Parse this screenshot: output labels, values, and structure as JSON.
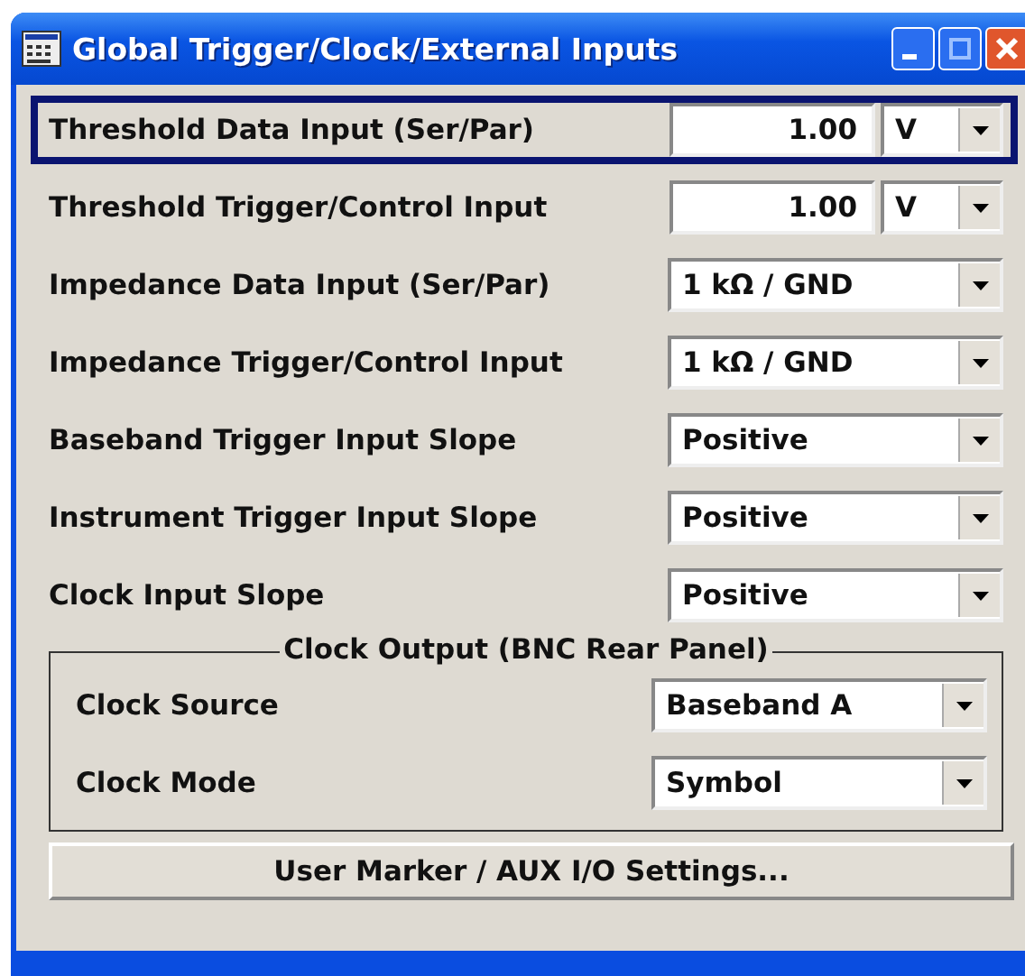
{
  "window": {
    "title": "Global Trigger/Clock/External Inputs"
  },
  "settings": [
    {
      "kind": "number",
      "label": "Threshold Data Input (Ser/Par)",
      "value": "1.00",
      "unit": "V",
      "focused": true
    },
    {
      "kind": "number",
      "label": "Threshold Trigger/Control Input",
      "value": "1.00",
      "unit": "V",
      "focused": false
    },
    {
      "kind": "dropdown",
      "label": "Impedance Data Input (Ser/Par)",
      "value": "1 kΩ / GND",
      "focused": false
    },
    {
      "kind": "dropdown",
      "label": "Impedance Trigger/Control Input",
      "value": "1 kΩ / GND",
      "focused": false
    },
    {
      "kind": "dropdown",
      "label": "Baseband Trigger Input Slope",
      "value": "Positive",
      "focused": false
    },
    {
      "kind": "dropdown",
      "label": "Instrument Trigger Input Slope",
      "value": "Positive",
      "focused": false
    },
    {
      "kind": "dropdown",
      "label": "Clock Input Slope",
      "value": "Positive",
      "focused": false
    }
  ],
  "clock_output": {
    "title": "Clock Output (BNC Rear Panel)",
    "settings": [
      {
        "kind": "dropdown",
        "label": "Clock Source",
        "value": "Baseband A",
        "focused": false
      },
      {
        "kind": "dropdown",
        "label": "Clock Mode",
        "value": "Symbol",
        "focused": false
      }
    ]
  },
  "button": "User Marker / AUX I/O Settings..."
}
